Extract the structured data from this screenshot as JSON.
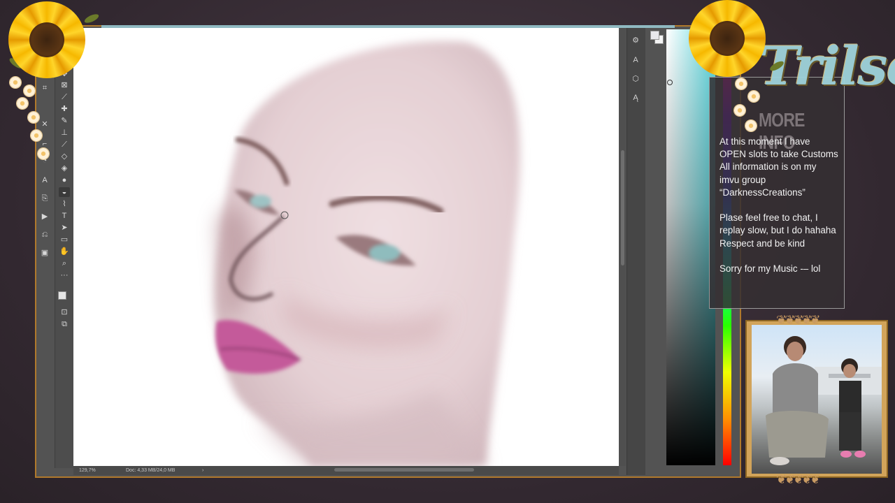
{
  "app": {
    "status_zoom": "129,7%",
    "status_doc": "Doc: 4,33 MB/24,0 MB",
    "status_arrow": "›"
  },
  "overlay": {
    "brand": "Trilse",
    "info_title": "MORE INFO",
    "info_text": "At this moment I have\nOPEN slots to take Customs\nAll information is on my\nimvu group\n“DarknessCreations”\n\nPlase feel free to chat, I\nreplay slow, but I do hahaha\nRespect and  be kind\n\nSorry for my Music -– lol"
  },
  "tools_left": [
    "move-icon",
    "marquee-icon",
    "lasso-icon",
    "quick-select-icon",
    "crop-icon",
    "frame-icon",
    "eyedropper-icon",
    "healing-icon",
    "brush-icon",
    "clone-stamp-icon",
    "history-brush-icon",
    "eraser-icon",
    "paint-bucket-icon",
    "blur-icon",
    "dodge-icon",
    "pen-icon",
    "type-icon",
    "path-select-icon",
    "rectangle-icon",
    "hand-icon",
    "zoom-icon",
    "more-icon"
  ],
  "panel_icons": [
    "adjustments-icon",
    "character-icon",
    "3d-icon",
    "paragraph-icon"
  ],
  "colors": {
    "accent_frame": "#b0792c",
    "color_field_hue": "#5fd7de",
    "canvas": "#ffffff",
    "ui_panel": "#535353"
  }
}
